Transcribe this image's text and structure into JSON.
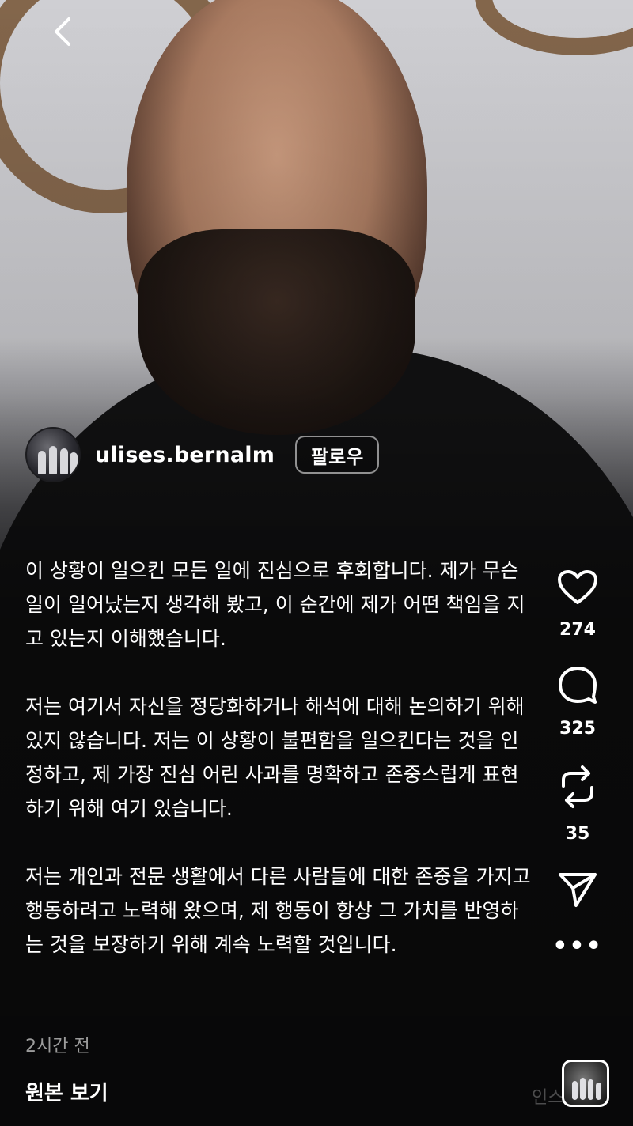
{
  "nav": {
    "back_icon": "chevron-left-icon"
  },
  "post": {
    "username": "ulises.bernalm",
    "follow_label": "팔로우",
    "caption": [
      "이 상황이 일으킨 모든 일에 진심으로 후회합니다. 제가 무슨 일이 일어났는지 생각해 봤고, 이 순간에 제가 어떤 책임을 지고 있는지 이해했습니다.",
      "저는 여기서 자신을 정당화하거나 해석에 대해 논의하기 위해 있지 않습니다. 저는 이 상황이 불편함을 일으킨다는 것을 인정하고, 제 가장 진심 어린 사과를 명확하고 존중스럽게 표현하기 위해 여기 있습니다.",
      "저는 개인과 전문 생활에서 다른 사람들에 대한 존중을 가지고 행동하려고 노력해 왔으며, 제 행동이 항상 그 가치를 반영하는 것을 보장하기 위해 계속 노력할 것입니다."
    ],
    "timestamp": "2시간 전",
    "view_original": "원본 보기"
  },
  "actions": {
    "likes": "274",
    "comments": "325",
    "reposts": "35",
    "more_label": "•••"
  },
  "watermark": "인스티즈",
  "colors": {
    "wood": "#7a5a3c",
    "text": "#ffffff"
  }
}
